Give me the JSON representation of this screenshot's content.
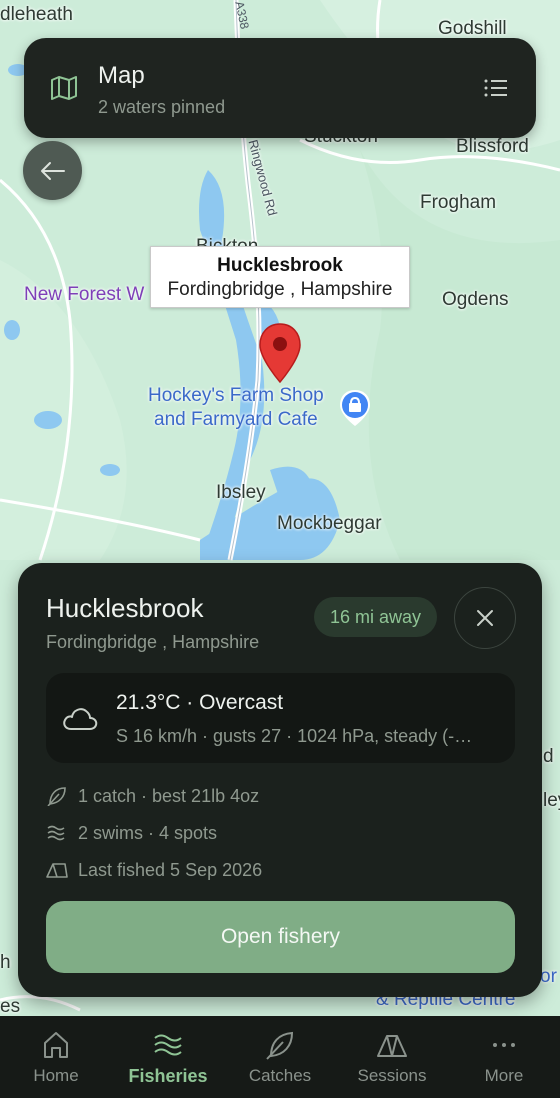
{
  "map": {
    "places": {
      "dleheath": "dleheath",
      "godshill": "Godshill",
      "stuckton": "Stuckton",
      "blissford": "Blissford",
      "frogham": "Frogham",
      "ogdens": "Ogdens",
      "bickton": "Bickton",
      "new_forest": "New Forest W",
      "ibsley": "Ibsley",
      "mockbeggar": "Mockbeggar",
      "right_edge_1": "d",
      "right_edge_2": "ley",
      "bottom_right_poi": "& Reptile Centre",
      "bottom_right_frag": "or",
      "bottom_left_frag": "h",
      "bottom_left_frag2": "es"
    },
    "road_label": "Ringwood Rd",
    "road_shield": "A338",
    "poi_name": "Hockey's Farm Shop\nand Farmyard Cafe",
    "callout": {
      "title": "Hucklesbrook",
      "subtitle": "Fordingbridge , Hampshire"
    }
  },
  "topbar": {
    "title": "Map",
    "subtitle": "2 waters pinned",
    "icon": "map-icon",
    "menu_icon": "list-icon"
  },
  "back_icon": "arrow-left-icon",
  "sheet": {
    "name": "Hucklesbrook",
    "location": "Fordingbridge , Hampshire",
    "distance": "16 mi away",
    "weather": {
      "headline": "21.3°C · Overcast",
      "detail": "S 16 km/h · gusts 27 · 1024 hPa, steady (-…"
    },
    "stats": {
      "catches": "1 catch · best 21lb 4oz",
      "swims": "2 swims · 4 spots",
      "last_fished": "Last fished 5 Sep 2026"
    },
    "open_button": "Open fishery"
  },
  "nav": {
    "items": [
      {
        "label": "Home",
        "icon": "home-icon"
      },
      {
        "label": "Fisheries",
        "icon": "waves-icon",
        "active": true
      },
      {
        "label": "Catches",
        "icon": "leaf-icon"
      },
      {
        "label": "Sessions",
        "icon": "tent-icon"
      },
      {
        "label": "More",
        "icon": "more-icon"
      }
    ]
  },
  "colors": {
    "accent": "#8fc495",
    "button": "#80ad86",
    "surface": "#1b211d",
    "pin": "#e53935"
  }
}
